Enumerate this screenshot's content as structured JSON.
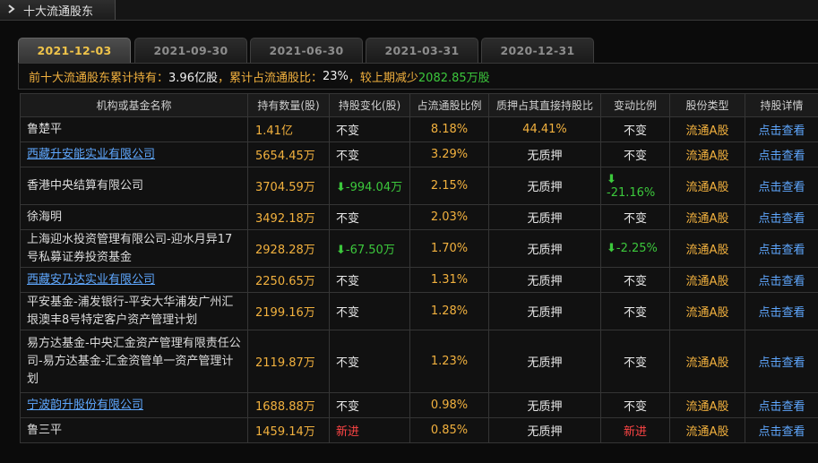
{
  "window": {
    "title": "十大流通股东",
    "title_icon": "chevron-right-icon"
  },
  "tabs": [
    {
      "label": "2021-12-03",
      "active": true
    },
    {
      "label": "2021-09-30",
      "active": false
    },
    {
      "label": "2021-06-30",
      "active": false
    },
    {
      "label": "2021-03-31",
      "active": false
    },
    {
      "label": "2020-12-31",
      "active": false
    }
  ],
  "summary": {
    "prefix": "前十大流通股东累计持有：",
    "holding": "3.96亿股",
    "sep1": "，累计占流通股比：",
    "ratio": "23%",
    "sep2": "，较上期减少",
    "decrease": "2082.85万股"
  },
  "table": {
    "headers": [
      "机构或基金名称",
      "持有数量(股)",
      "持股变化(股)",
      "占流通股比例",
      "质押占其直接持股比",
      "变动比例",
      "股份类型",
      "持股详情"
    ],
    "rows": [
      {
        "name": "鲁楚平",
        "link": false,
        "qty": "1.41亿",
        "change": "不变",
        "change_dir": "none",
        "ratio": "8.18%",
        "pledge": "44.41%",
        "pledge_color": "orange",
        "chg_ratio": "不变",
        "chg_dir": "none",
        "type": "流通A股",
        "detail": "点击查看"
      },
      {
        "name": "西藏升安能实业有限公司",
        "link": true,
        "qty": "5654.45万",
        "change": "不变",
        "change_dir": "none",
        "ratio": "3.29%",
        "pledge": "无质押",
        "pledge_color": "white",
        "chg_ratio": "不变",
        "chg_dir": "none",
        "type": "流通A股",
        "detail": "点击查看"
      },
      {
        "name": "香港中央结算有限公司",
        "link": false,
        "qty": "3704.59万",
        "change": "-994.04万",
        "change_dir": "down",
        "ratio": "2.15%",
        "pledge": "无质押",
        "pledge_color": "white",
        "chg_ratio": "-21.16%",
        "chg_dir": "down",
        "type": "流通A股",
        "detail": "点击查看"
      },
      {
        "name": "徐海明",
        "link": false,
        "qty": "3492.18万",
        "change": "不变",
        "change_dir": "none",
        "ratio": "2.03%",
        "pledge": "无质押",
        "pledge_color": "white",
        "chg_ratio": "不变",
        "chg_dir": "none",
        "type": "流通A股",
        "detail": "点击查看"
      },
      {
        "name": "上海迎水投资管理有限公司-迎水月异17号私募证券投资基金",
        "link": false,
        "qty": "2928.28万",
        "change": "-67.50万",
        "change_dir": "down",
        "ratio": "1.70%",
        "pledge": "无质押",
        "pledge_color": "white",
        "chg_ratio": "-2.25%",
        "chg_dir": "down",
        "type": "流通A股",
        "detail": "点击查看"
      },
      {
        "name": "西藏安乃达实业有限公司",
        "link": true,
        "qty": "2250.65万",
        "change": "不变",
        "change_dir": "none",
        "ratio": "1.31%",
        "pledge": "无质押",
        "pledge_color": "white",
        "chg_ratio": "不变",
        "chg_dir": "none",
        "type": "流通A股",
        "detail": "点击查看"
      },
      {
        "name": "平安基金-浦发银行-平安大华浦发广州汇垠澳丰8号特定客户资产管理计划",
        "link": false,
        "qty": "2199.16万",
        "change": "不变",
        "change_dir": "none",
        "ratio": "1.28%",
        "pledge": "无质押",
        "pledge_color": "white",
        "chg_ratio": "不变",
        "chg_dir": "none",
        "type": "流通A股",
        "detail": "点击查看"
      },
      {
        "name": "易方达基金-中央汇金资产管理有限责任公司-易方达基金-汇金资管单一资产管理计划",
        "link": false,
        "qty": "2119.87万",
        "change": "不变",
        "change_dir": "none",
        "ratio": "1.23%",
        "pledge": "无质押",
        "pledge_color": "white",
        "chg_ratio": "不变",
        "chg_dir": "none",
        "type": "流通A股",
        "detail": "点击查看"
      },
      {
        "name": "宁波韵升股份有限公司",
        "link": true,
        "qty": "1688.88万",
        "change": "不变",
        "change_dir": "none",
        "ratio": "0.98%",
        "pledge": "无质押",
        "pledge_color": "white",
        "chg_ratio": "不变",
        "chg_dir": "none",
        "type": "流通A股",
        "detail": "点击查看"
      },
      {
        "name": "鲁三平",
        "link": false,
        "qty": "1459.14万",
        "change": "新进",
        "change_dir": "new",
        "ratio": "0.85%",
        "pledge": "无质押",
        "pledge_color": "white",
        "chg_ratio": "新进",
        "chg_dir": "new",
        "type": "流通A股",
        "detail": "点击查看"
      }
    ]
  },
  "colors": {
    "accent_orange": "#f2b13e",
    "up_red": "#ff4545",
    "down_green": "#3cc83c",
    "link_blue": "#5fa8ff",
    "active_tab": "#f0c44a"
  }
}
